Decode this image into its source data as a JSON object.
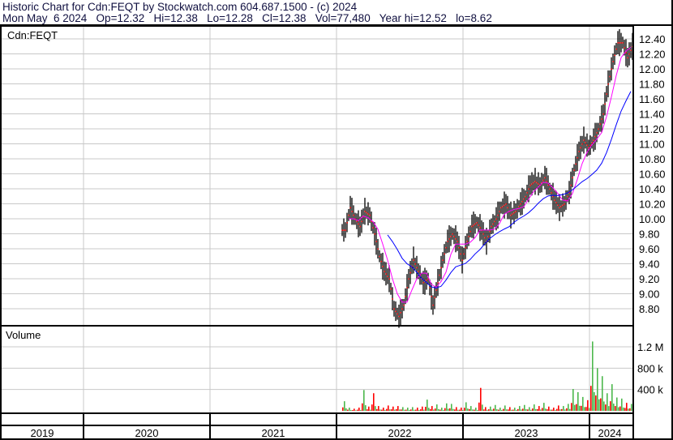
{
  "header": {
    "line1": "Historic Chart for Cdn:FEQT by Stockwatch.com 604.687.1500 - (c) 2024",
    "line2": "Mon May  6 2024   Op=12.32   Hi=12.38   Lo=12.28   Cl=12.38   Vol=77,480   Year hi=12.52   lo=8.62"
  },
  "chart_data": {
    "type": "line",
    "title": "Cdn:FEQT",
    "price_panel_label": "Cdn:FEQT",
    "volume_panel_label": "Volume",
    "ylim": [
      8.62,
      12.52
    ],
    "price_ticks": [
      "12.40",
      "12.20",
      "12.00",
      "11.80",
      "11.60",
      "11.40",
      "11.20",
      "11.00",
      "10.80",
      "10.60",
      "10.40",
      "10.20",
      "10.00",
      "9.80",
      "9.60",
      "9.40",
      "9.20",
      "9.00",
      "8.80"
    ],
    "volume_ticks": [
      {
        "label": "1.2 M",
        "value": 1200
      },
      {
        "label": "800 k",
        "value": 800
      },
      {
        "label": "400 k",
        "value": 400
      }
    ],
    "years": [
      "2019",
      "2020",
      "2021",
      "2022",
      "2023",
      "2024"
    ],
    "series": [
      {
        "name": "close",
        "color": "#000000",
        "values": [
          9.85,
          10.15,
          10.0,
          9.9,
          10.1,
          10.05,
          9.8,
          9.5,
          9.3,
          9.2,
          8.8,
          8.7,
          8.85,
          9.2,
          9.45,
          9.3,
          9.15,
          9.2,
          8.85,
          9.15,
          9.45,
          9.7,
          9.8,
          9.7,
          9.45,
          9.7,
          9.9,
          9.95,
          9.85,
          9.7,
          9.9,
          10.0,
          10.15,
          10.2,
          10.05,
          10.1,
          10.2,
          10.3,
          10.45,
          10.5,
          10.45,
          10.55,
          10.4,
          10.25,
          10.15,
          10.2,
          10.35,
          10.65,
          10.9,
          11.05,
          10.95,
          11.05,
          11.2,
          11.4,
          11.8,
          12.1,
          12.35,
          12.35,
          12.15,
          12.3
        ]
      },
      {
        "name": "short moving average",
        "color": "#ff00ff"
      },
      {
        "name": "long moving average",
        "color": "#0000ff"
      },
      {
        "name": "volume (k)",
        "values": [
          180,
          60,
          40,
          60,
          390,
          80,
          330,
          90,
          60,
          100,
          80,
          90,
          70,
          60,
          70,
          60,
          80,
          210,
          90,
          120,
          60,
          140,
          130,
          70,
          60,
          160,
          90,
          60,
          430,
          70,
          80,
          110,
          60,
          100,
          70,
          60,
          90,
          110,
          70,
          120,
          90,
          150,
          80,
          60,
          100,
          90,
          130,
          410,
          350,
          260,
          200,
          1300,
          800,
          650,
          330,
          500,
          250,
          230,
          150,
          130
        ]
      }
    ]
  }
}
